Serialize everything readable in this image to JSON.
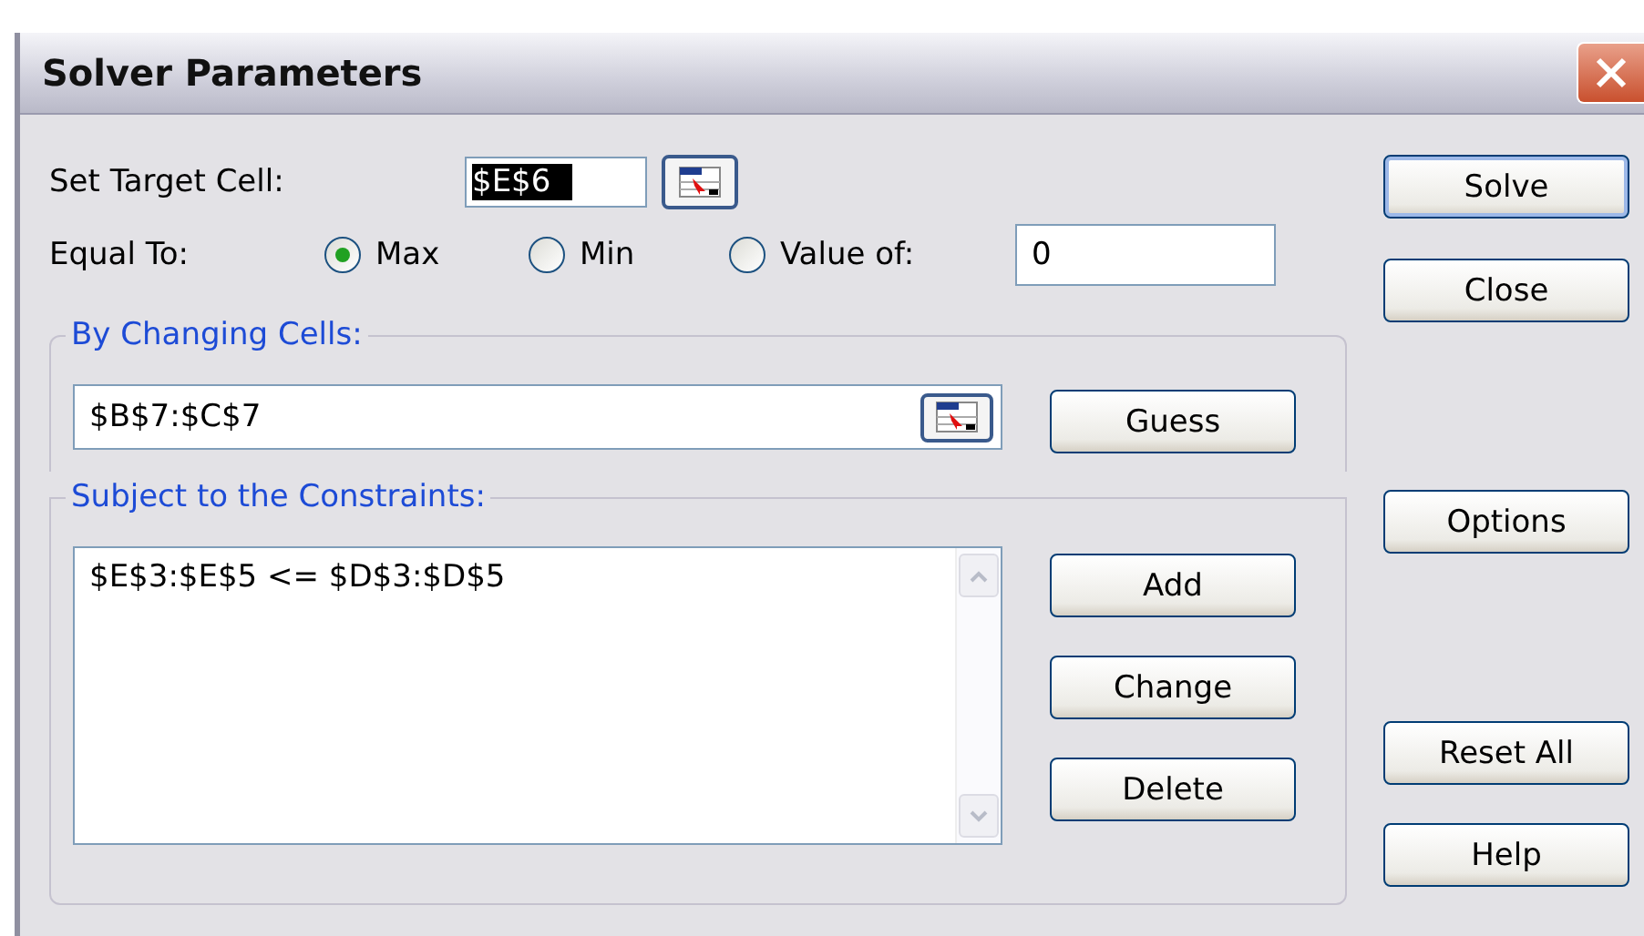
{
  "window": {
    "title": "Solver Parameters"
  },
  "target_cell": {
    "label": "Set Target Cell:",
    "value": "$E$6"
  },
  "equal_to": {
    "label": "Equal To:",
    "options": [
      {
        "label": "Max",
        "selected": true
      },
      {
        "label": "Min",
        "selected": false
      },
      {
        "label": "Value of:",
        "selected": false
      }
    ],
    "value": "0"
  },
  "changing_cells": {
    "title": "By Changing Cells:",
    "value": "$B$7:$C$7",
    "button": "Guess"
  },
  "constraints": {
    "title": "Subject to the Constraints:",
    "items": [
      "$E$3:$E$5 <= $D$3:$D$5"
    ],
    "buttons": [
      "Add",
      "Change",
      "Delete"
    ]
  },
  "side_buttons": [
    {
      "label": "Solve",
      "focused": true
    },
    {
      "label": "Close",
      "focused": false
    },
    {
      "label": "Options",
      "focused": false
    },
    {
      "label": "Reset All",
      "focused": false
    },
    {
      "label": "Help",
      "focused": false
    }
  ]
}
